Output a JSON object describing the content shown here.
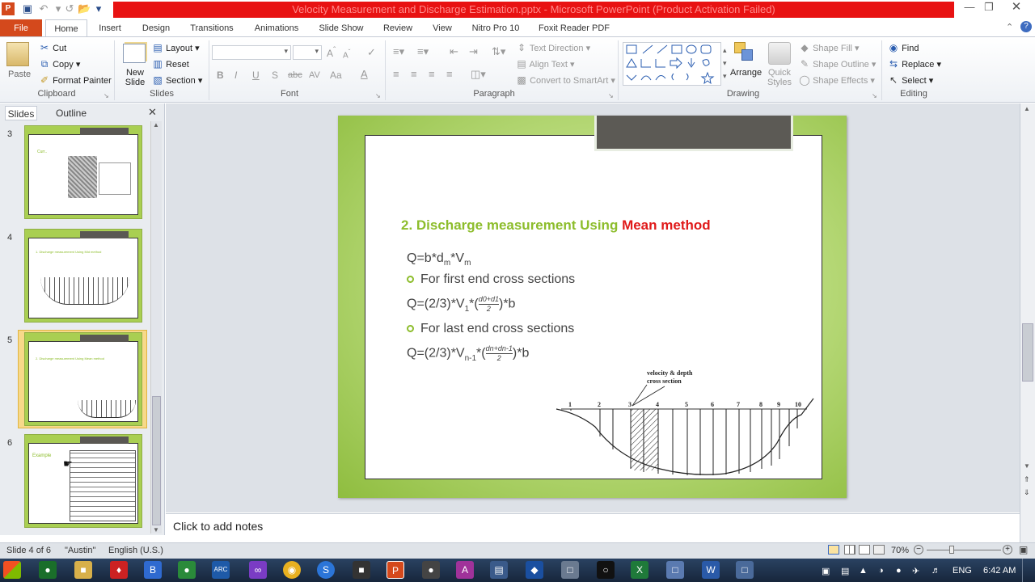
{
  "titlebar": {
    "title": "Velocity Measurement and Discharge Estimation.pptx - Microsoft PowerPoint (Product Activation Failed)"
  },
  "ribbon_tabs": [
    "File",
    "Home",
    "Insert",
    "Design",
    "Transitions",
    "Animations",
    "Slide Show",
    "Review",
    "View",
    "Nitro Pro 10",
    "Foxit Reader PDF"
  ],
  "clipboard": {
    "paste": "Paste",
    "cut": "Cut",
    "copy": "Copy",
    "format_painter": "Format Painter",
    "label": "Clipboard"
  },
  "slides_group": {
    "new_slide": "New Slide",
    "layout": "Layout",
    "reset": "Reset",
    "section": "Section",
    "label": "Slides"
  },
  "font_group": {
    "label": "Font",
    "bold": "B",
    "italic": "I",
    "underline": "U",
    "shadow": "S",
    "strike": "abc",
    "spacing": "AV",
    "case": "Aa",
    "color": "A"
  },
  "paragraph_group": {
    "text_direction": "Text Direction",
    "align_text": "Align Text",
    "convert_smartart": "Convert to SmartArt",
    "label": "Paragraph"
  },
  "drawing_group": {
    "arrange": "Arrange",
    "quick_styles": "Quick Styles",
    "shape_fill": "Shape Fill",
    "shape_outline": "Shape Outline",
    "shape_effects": "Shape Effects",
    "label": "Drawing"
  },
  "editing_group": {
    "find": "Find",
    "replace": "Replace",
    "select": "Select",
    "label": "Editing"
  },
  "pane_tabs": {
    "slides": "Slides",
    "outline": "Outline"
  },
  "thumbnails": [
    {
      "num": "3",
      "selected": false
    },
    {
      "num": "4",
      "selected": false
    },
    {
      "num": "5",
      "selected": true
    },
    {
      "num": "6",
      "selected": false
    }
  ],
  "thumb_text": {
    "t3_title": "Curr..",
    "t4_title": "1. Discharge measurement Using Mid method",
    "t5_title": "2. Discharge measurement Using Mean method",
    "t6_title": "Example"
  },
  "slide": {
    "title_green": "2. Discharge measurement Using",
    "title_red": "Mean method",
    "formula1": "Q=b*d",
    "formula1_sub1": "m",
    "formula1_mid": "*V",
    "formula1_sub2": "m",
    "bullet1": "For first end cross sections",
    "formula2_pre": "Q=(2/3)*V",
    "formula2_sub": "1",
    "formula2_num": "d0+d1",
    "formula2_den": "2",
    "formula2_post": ")*b",
    "bullet2": "For last end cross sections",
    "formula3_pre": "Q=(2/3)*V",
    "formula3_sub": "n-1",
    "formula3_num": "dn+dn-1",
    "formula3_den": "2",
    "formula3_post": ")*b",
    "diagram_label_line1": "velocity & depth",
    "diagram_label_line2": "cross section",
    "verticals": [
      "1",
      "2",
      "3",
      "4",
      "5",
      "6",
      "7",
      "8",
      "9",
      "10"
    ]
  },
  "notes": {
    "placeholder": "Click to add notes"
  },
  "status": {
    "slide_info": "Slide 4 of 6",
    "theme": "\"Austin\"",
    "language": "English (U.S.)",
    "zoom": "70%"
  },
  "taskbar": {
    "lang": "ENG",
    "time": "6:42 AM"
  }
}
